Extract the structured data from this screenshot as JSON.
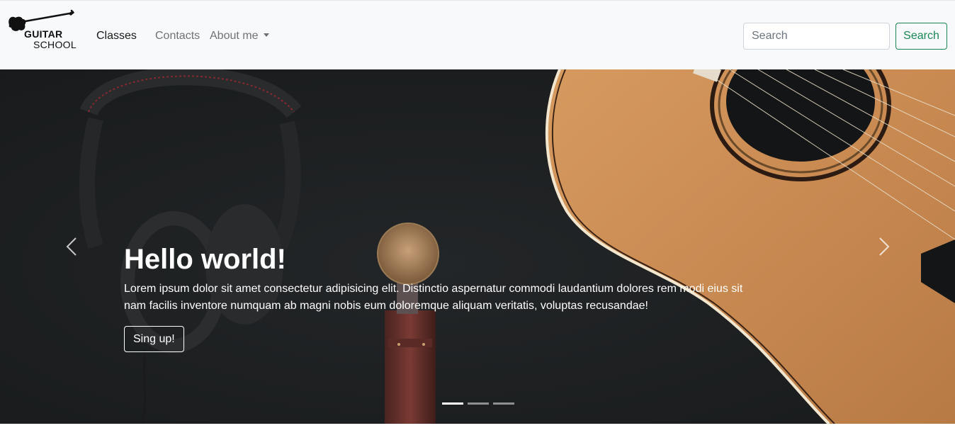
{
  "brand": {
    "line1": "GUITAR",
    "line2": "SCHOOL",
    "logo_icon": "electric-guitar-icon"
  },
  "nav": {
    "items": [
      {
        "label": "Classes",
        "active": true
      },
      {
        "label": "Contacts",
        "active": false
      },
      {
        "label": "About me",
        "active": false,
        "dropdown": true
      }
    ]
  },
  "search": {
    "placeholder": "Search",
    "value": "",
    "button_label": "Search",
    "button_color": "#198754"
  },
  "carousel": {
    "slide_count": 3,
    "active_index": 0,
    "caption": {
      "title": "Hello world!",
      "text": "Lorem ipsum dolor sit amet consectetur adipisicing elit. Distinctio aspernatur commodi laudantium dolores rem modi eius sit nam facilis inventore numquam ab magni nobis eum doloremque aliquam veritatis, voluptas recusandae!",
      "button_label": "Sing up!"
    },
    "prev_icon": "chevron-left-icon",
    "next_icon": "chevron-right-icon",
    "image_subjects": [
      "headphones",
      "microphone",
      "acoustic-guitar"
    ]
  }
}
